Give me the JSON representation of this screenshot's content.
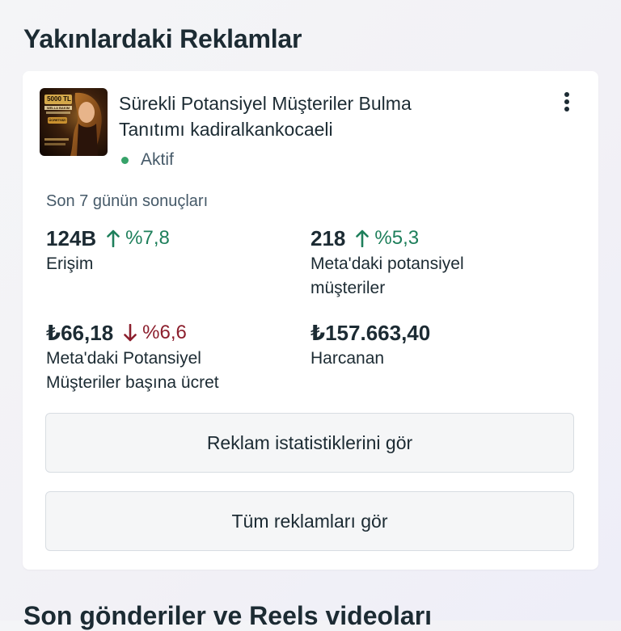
{
  "section": {
    "title": "Yakınlardaki Reklamlar"
  },
  "ad": {
    "title_line1": "Sürekli Potansiyel Müşteriler Bulma",
    "title_line2": "Tanıtımı kadiralkankocaeli",
    "status": "Aktif",
    "status_color": "#36a269",
    "thumbnail": {
      "price_text": "5000 TL",
      "brand_text": "WELLA BAKIM",
      "free_text": "ÜCRETSİZ!"
    }
  },
  "results": {
    "period_label": "Son 7 günün sonuçları",
    "metrics": [
      {
        "value": "124B",
        "trend": "up",
        "trend_icon": "arrow-up-icon",
        "change": "%7,8",
        "label": "Erişim"
      },
      {
        "value": "218",
        "trend": "up",
        "trend_icon": "arrow-up-icon",
        "change": "%5,3",
        "label_line1": "Meta'daki potansiyel",
        "label_line2": "müşteriler"
      },
      {
        "value": "₺66,18",
        "trend": "down",
        "trend_icon": "arrow-down-icon",
        "change": "%6,6",
        "label_line1": "Meta'daki Potansiyel",
        "label_line2": "Müşteriler başına ücret"
      },
      {
        "value": "₺157.663,40",
        "label": "Harcanan"
      }
    ],
    "up_color": "#1e7f5b",
    "down_color": "#8c1f2d"
  },
  "buttons": {
    "stats": "Reklam istatistiklerini gör",
    "all_ads": "Tüm reklamları gör"
  },
  "next_section": {
    "title": "Son gönderiler ve Reels videoları"
  },
  "icons": {
    "more": "more-vertical-icon"
  }
}
